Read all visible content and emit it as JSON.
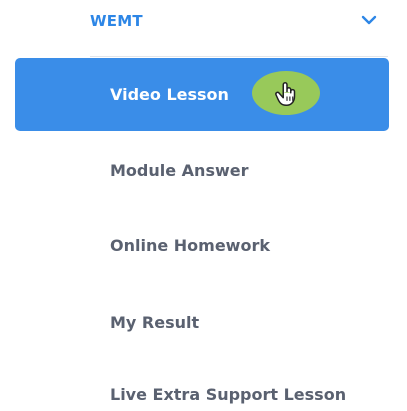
{
  "section": {
    "title": "WEMT",
    "toggle_icon": "chevron-down-icon"
  },
  "menu": {
    "items": [
      {
        "label": "Video Lesson",
        "active": true
      },
      {
        "label": "Module Answer",
        "active": false
      },
      {
        "label": "Online Homework",
        "active": false
      },
      {
        "label": "My Result",
        "active": false
      },
      {
        "label": "Live Extra Support Lesson",
        "active": false
      }
    ]
  },
  "cursor": {
    "icon": "hand-pointer-icon",
    "highlight_color": "#98c95a"
  },
  "colors": {
    "accent": "#2d86e6",
    "active_bg": "#3a8de8",
    "item_text": "#5a6170"
  }
}
